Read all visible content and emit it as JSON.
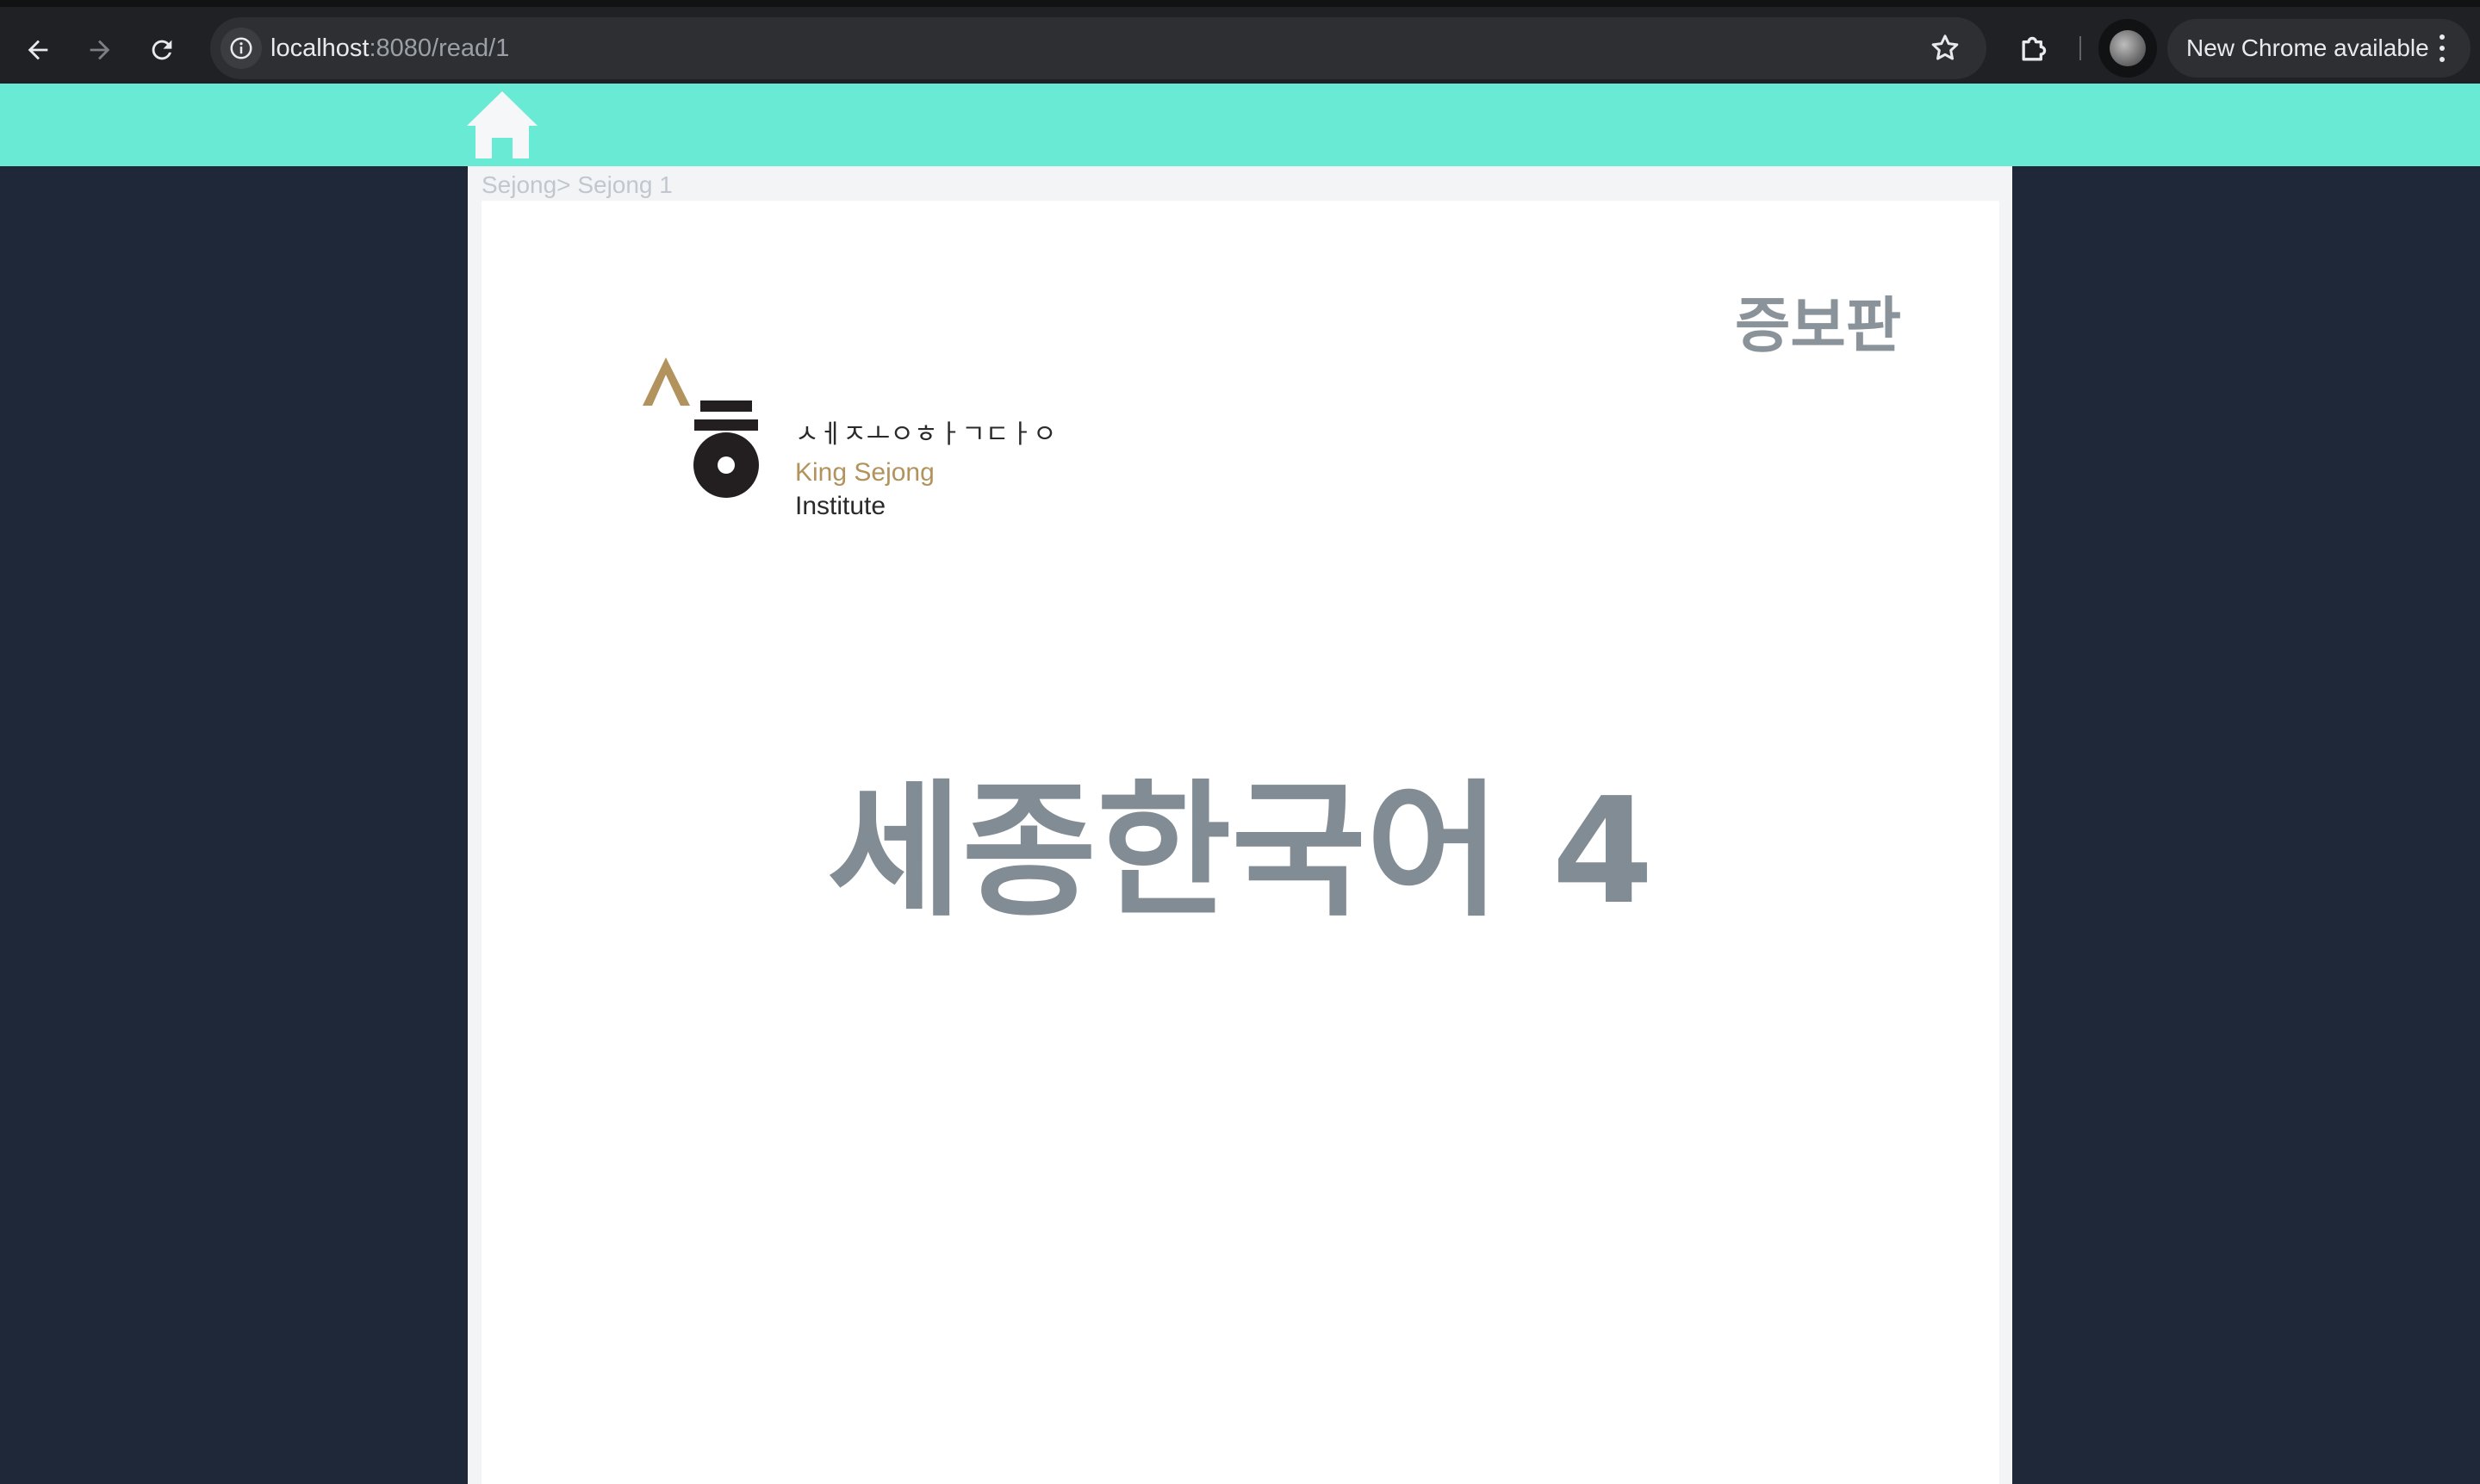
{
  "browser": {
    "url_host": "localhost",
    "url_path": ":8080/read/1",
    "update_label": "New Chrome available"
  },
  "reader": {
    "breadcrumb": "Sejong> Sejong 1",
    "page": {
      "edition_label": "증보판",
      "logo": {
        "korean_text": "ㅅㅔㅈㅗㅇㅎㅏㄱㄷㅏㅇ",
        "english_line1": "King Sejong",
        "english_line2": "Institute"
      },
      "title": "세종한국어 4"
    }
  },
  "colors": {
    "header_bg": "#68ead4",
    "page_bg": "#1f2838",
    "title_gray": "#818c94",
    "logo_gold": "#b2935d"
  }
}
